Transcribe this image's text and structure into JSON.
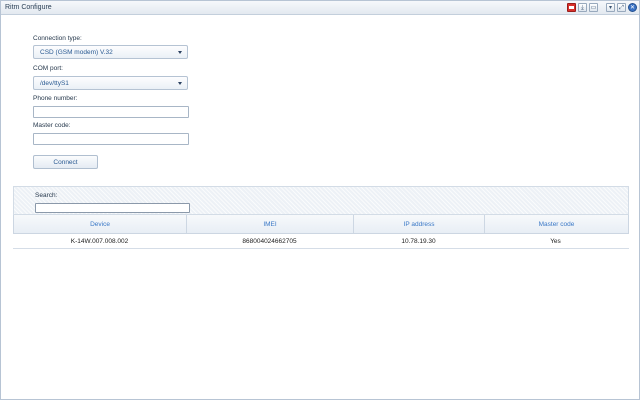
{
  "window": {
    "title": "Ritm Configure",
    "toolbar_icons": [
      "flag-icon",
      "download-icon",
      "folder-icon",
      "minimize-icon",
      "maximize-icon",
      "close-icon"
    ],
    "toolbar_glyphs": {
      "download": "⤓",
      "folder": "▭",
      "minimize": "▾",
      "maximize": "⤢",
      "close": "✕"
    }
  },
  "form": {
    "connection_type_label": "Connection type:",
    "connection_type_value": "CSD (GSM modem) V.32",
    "com_port_label": "COM port:",
    "com_port_value": "/dev/ttyS1",
    "phone_label": "Phone number:",
    "phone_value": "",
    "master_code_label": "Master code:",
    "master_code_value": "",
    "connect_label": "Connect"
  },
  "search": {
    "label": "Search:",
    "value": ""
  },
  "table": {
    "columns": [
      "Device",
      "IMEI",
      "IP address",
      "Master code"
    ],
    "rows": [
      [
        "K-14W.007.008.002",
        "868004024662705",
        "10.78.19.30",
        "Yes"
      ]
    ]
  },
  "colors": {
    "accent": "#3a78c6",
    "title_text": "#2a3f55",
    "close_button": "#3a72c4",
    "flag_button": "#d9302b"
  }
}
